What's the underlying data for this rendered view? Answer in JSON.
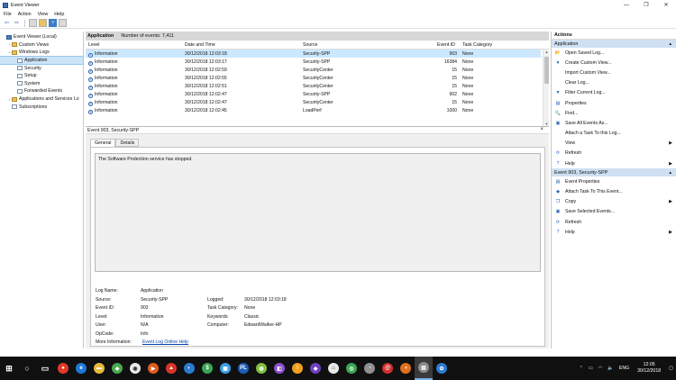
{
  "window": {
    "title": "Event Viewer",
    "minimize": "—",
    "restore": "❐",
    "close": "✕"
  },
  "menu": [
    "File",
    "Action",
    "View",
    "Help"
  ],
  "toolbar": {
    "back": "⇦",
    "forward": "⇨",
    "help": "?"
  },
  "tree": [
    {
      "label": "Event Viewer (Local)",
      "level": 0,
      "twisty": "",
      "icon": "ev"
    },
    {
      "label": "Custom Views",
      "level": 1,
      "twisty": "›",
      "icon": "folder"
    },
    {
      "label": "Windows Logs",
      "level": 1,
      "twisty": "⌄",
      "icon": "folder"
    },
    {
      "label": "Application",
      "level": 2,
      "twisty": "",
      "icon": "log",
      "selected": true
    },
    {
      "label": "Security",
      "level": 2,
      "twisty": "",
      "icon": "log"
    },
    {
      "label": "Setup",
      "level": 2,
      "twisty": "",
      "icon": "log"
    },
    {
      "label": "System",
      "level": 2,
      "twisty": "",
      "icon": "log"
    },
    {
      "label": "Forwarded Events",
      "level": 2,
      "twisty": "",
      "icon": "log"
    },
    {
      "label": "Applications and Services Lo",
      "level": 1,
      "twisty": "›",
      "icon": "folder"
    },
    {
      "label": "Subscriptions",
      "level": 1,
      "twisty": "",
      "icon": "log"
    }
  ],
  "grid": {
    "log_name": "Application",
    "count_label": "Number of events: 7,411",
    "columns": [
      "Level",
      "Date and Time",
      "Source",
      "Event ID",
      "Task Category"
    ],
    "rows": [
      [
        "Information",
        "30/12/2018 12:03:18",
        "Security-SPP",
        "903",
        "None"
      ],
      [
        "Information",
        "30/12/2018 12:03:17",
        "Security-SPP",
        "16384",
        "None"
      ],
      [
        "Information",
        "30/12/2018 12:02:59",
        "SecurityCenter",
        "15",
        "None"
      ],
      [
        "Information",
        "30/12/2018 12:02:55",
        "SecurityCenter",
        "15",
        "None"
      ],
      [
        "Information",
        "30/12/2018 12:02:51",
        "SecurityCenter",
        "15",
        "None"
      ],
      [
        "Information",
        "30/12/2018 12:02:47",
        "Security-SPP",
        "902",
        "None"
      ],
      [
        "Information",
        "30/12/2018 12:02:47",
        "SecurityCenter",
        "15",
        "None"
      ],
      [
        "Information",
        "30/12/2018 12:02:45",
        "LoadPerf",
        "1000",
        "None"
      ]
    ]
  },
  "detail": {
    "title": "Event 903, Security-SPP",
    "close": "×",
    "tabs": [
      "General",
      "Details"
    ],
    "message": "The Software Protection service has stopped.",
    "left_props": [
      [
        "Log Name:",
        "Application"
      ],
      [
        "Source:",
        "Security-SPP"
      ],
      [
        "Event ID:",
        "903"
      ],
      [
        "Level:",
        "Information"
      ],
      [
        "User:",
        "N/A"
      ],
      [
        "OpCode:",
        "Info"
      ],
      [
        "More Information:",
        "Event Log Online Help"
      ]
    ],
    "right_props": [
      [
        "Logged:",
        "30/12/2018 12:03:18"
      ],
      [
        "Task Category:",
        "None"
      ],
      [
        "Keywords:",
        "Classic"
      ],
      [
        "Computer:",
        "EdwardWalker-HP"
      ]
    ]
  },
  "actions": {
    "header": "Actions",
    "section1": "Application",
    "items1": [
      {
        "label": "Open Saved Log...",
        "icon": "folder-open-icon",
        "glyph": "📂",
        "arrow": ""
      },
      {
        "label": "Create Custom View...",
        "icon": "filter-icon",
        "glyph": "▼",
        "arrow": ""
      },
      {
        "label": "Import Custom View...",
        "icon": "",
        "glyph": "",
        "arrow": ""
      },
      {
        "label": "Clear Log...",
        "icon": "",
        "glyph": "",
        "arrow": ""
      },
      {
        "label": "Filter Current Log...",
        "icon": "filter-icon",
        "glyph": "▼",
        "arrow": ""
      },
      {
        "label": "Properties",
        "icon": "properties-icon",
        "glyph": "▤",
        "arrow": ""
      },
      {
        "label": "Find...",
        "icon": "find-icon",
        "glyph": "🔍",
        "arrow": ""
      },
      {
        "label": "Save All Events As...",
        "icon": "save-icon",
        "glyph": "▣",
        "arrow": ""
      },
      {
        "label": "Attach a Task To this Log...",
        "icon": "",
        "glyph": "",
        "arrow": ""
      },
      {
        "label": "View",
        "icon": "",
        "glyph": "",
        "arrow": "▶"
      },
      {
        "label": "Refresh",
        "icon": "refresh-icon",
        "glyph": "⟳",
        "arrow": ""
      },
      {
        "label": "Help",
        "icon": "help-icon",
        "glyph": "?",
        "arrow": "▶"
      }
    ],
    "section2": "Event 903, Security-SPP",
    "items2": [
      {
        "label": "Event Properties",
        "icon": "properties-icon",
        "glyph": "▤",
        "arrow": ""
      },
      {
        "label": "Attach Task To This Event...",
        "icon": "task-icon",
        "glyph": "◆",
        "arrow": ""
      },
      {
        "label": "Copy",
        "icon": "copy-icon",
        "glyph": "❐",
        "arrow": "▶"
      },
      {
        "label": "Save Selected Events...",
        "icon": "save-icon",
        "glyph": "▣",
        "arrow": ""
      },
      {
        "label": "Refresh",
        "icon": "refresh-icon",
        "glyph": "⟳",
        "arrow": ""
      },
      {
        "label": "Help",
        "icon": "help-icon",
        "glyph": "?",
        "arrow": "▶"
      }
    ],
    "collapse": "▲"
  },
  "taskbar": {
    "apps": [
      {
        "name": "start-icon",
        "glyph": "⊞",
        "color": "#101010"
      },
      {
        "name": "cortana-icon",
        "glyph": "○",
        "color": "#101010"
      },
      {
        "name": "task-view-icon",
        "glyph": "▭",
        "color": "#101010"
      },
      {
        "name": "chrome-icon",
        "glyph": "●",
        "color": "#e0392b"
      },
      {
        "name": "edge-icon",
        "glyph": "e",
        "color": "#1e78d7"
      },
      {
        "name": "explorer-icon",
        "glyph": "▬",
        "color": "#e6b93a"
      },
      {
        "name": "app-icon",
        "glyph": "◈",
        "color": "#4aa84f"
      },
      {
        "name": "app-icon",
        "glyph": "◉",
        "color": "#e9e9e9"
      },
      {
        "name": "app-icon",
        "glyph": "▶",
        "color": "#e25a1c"
      },
      {
        "name": "app-icon",
        "glyph": "▲",
        "color": "#d8352b"
      },
      {
        "name": "app-icon",
        "glyph": "◐",
        "color": "#2b7bd1"
      },
      {
        "name": "app-icon",
        "glyph": "$",
        "color": "#3aa655"
      },
      {
        "name": "app-icon",
        "glyph": "▣",
        "color": "#3ba0e6"
      },
      {
        "name": "app-icon",
        "glyph": "PL",
        "color": "#1d5fb8"
      },
      {
        "name": "app-icon",
        "glyph": "◍",
        "color": "#7fbf3f"
      },
      {
        "name": "app-icon",
        "glyph": "◧",
        "color": "#8a4fd0"
      },
      {
        "name": "app-icon",
        "glyph": "!",
        "color": "#f0a020"
      },
      {
        "name": "app-icon",
        "glyph": "◆",
        "color": "#7040c0"
      },
      {
        "name": "app-icon",
        "glyph": "⌂",
        "color": "#e8e8e8"
      },
      {
        "name": "app-icon",
        "glyph": "◎",
        "color": "#3aa655"
      },
      {
        "name": "app-icon",
        "glyph": "◔",
        "color": "#909090"
      },
      {
        "name": "app-icon",
        "glyph": "@",
        "color": "#d03030"
      },
      {
        "name": "app-icon",
        "glyph": "◑",
        "color": "#e07020"
      },
      {
        "name": "event-viewer-taskbar-icon",
        "glyph": "▤",
        "color": "#8b8b8b",
        "active": true
      },
      {
        "name": "app-icon",
        "glyph": "✿",
        "color": "#2b7bd1"
      }
    ],
    "lang": "ENG",
    "time": "12:05",
    "date": "30/12/2018"
  }
}
